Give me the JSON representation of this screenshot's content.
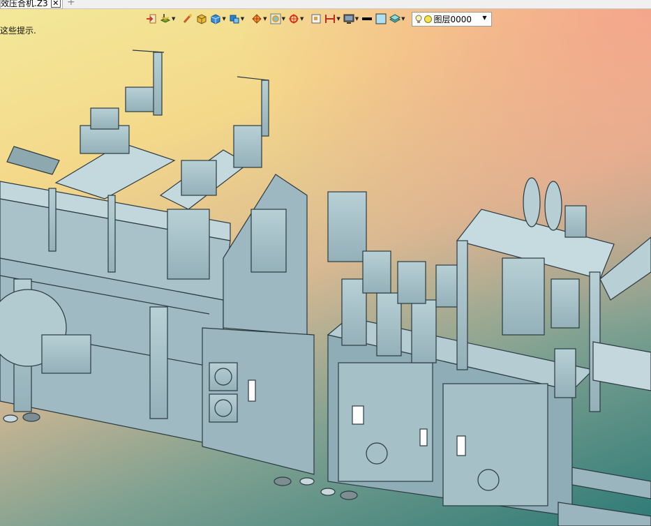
{
  "tab": {
    "title": "效压合机.Z3",
    "close_glyph": "✕",
    "add_glyph": "+"
  },
  "hint_text": "这些提示.",
  "toolbar": {
    "icons": [
      "import-icon",
      "layers-stack-icon",
      "brush-icon",
      "box-icon",
      "solid-cube-icon",
      "blocks-icon",
      "shape-tool-icon",
      "frame-icon",
      "move-target-icon",
      "rect-view-icon",
      "dimension-icon",
      "monitor-icon",
      "line-color-swatch",
      "fill-color-swatch",
      "layer-stack-icon"
    ],
    "layer_label": "图层0000"
  },
  "colors": {
    "machine_face": "#a8c4cc",
    "machine_dark": "#7d9aa3",
    "machine_edge": "#2b3a40"
  }
}
